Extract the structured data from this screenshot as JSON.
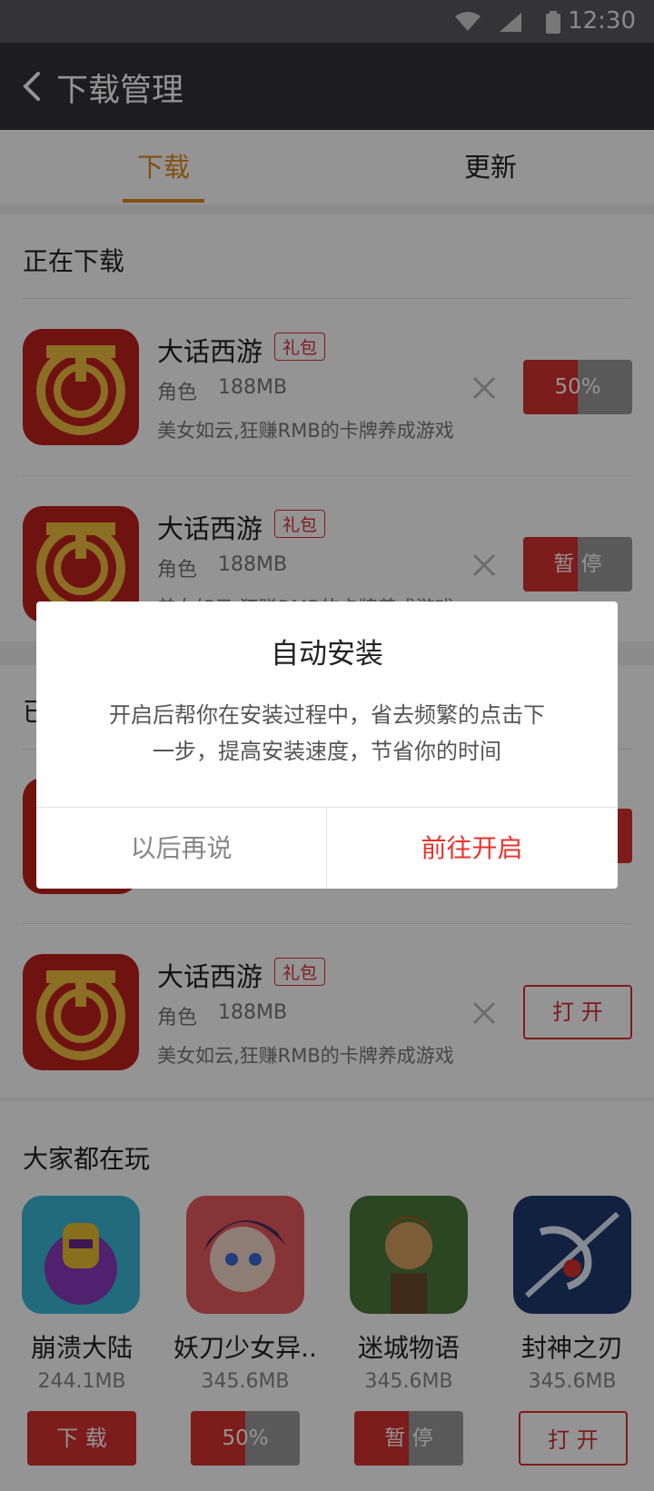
{
  "status_bar": {
    "time": "12:30"
  },
  "header": {
    "title": "下载管理"
  },
  "tabs": [
    {
      "label": "下载"
    },
    {
      "label": "更新"
    }
  ],
  "downloading": {
    "title": "正在下载",
    "items": [
      {
        "name": "大话西游",
        "badge": "礼包",
        "category": "角色",
        "size": "188MB",
        "desc": "美女如云,狂赚RMB的卡牌养成游戏",
        "action": "50%",
        "progress": 0.5
      },
      {
        "name": "大话西游",
        "badge": "礼包",
        "category": "角色",
        "size": "188MB",
        "desc": "美女如云,狂赚RMB的卡牌养成游戏",
        "action": "暂 停",
        "progress": 0.5
      }
    ]
  },
  "downloaded": {
    "title": "已",
    "items": [
      {
        "name": "大话西游",
        "badge": "礼包",
        "category": "角色",
        "size": "188MB",
        "desc": "美女如云,狂赚RMB的卡牌养成游戏",
        "action": "打 开"
      }
    ]
  },
  "popular": {
    "title": "大家都在玩",
    "items": [
      {
        "name": "崩溃大陆",
        "size": "244.1MB",
        "action": "下 载",
        "progress": 1.0
      },
      {
        "name": "妖刀少女异..",
        "size": "345.6MB",
        "action": "50%",
        "progress": 0.5
      },
      {
        "name": "迷城物语",
        "size": "345.6MB",
        "action": "暂 停",
        "progress": 0.5
      },
      {
        "name": "封神之刃",
        "size": "345.6MB",
        "action": "打 开"
      }
    ]
  },
  "dialog": {
    "title": "自动安装",
    "body": "开启后帮你在安装过程中，省去频繁的点击下一步，提高安装速度，节省你的时间",
    "cancel": "以后再说",
    "confirm": "前往开启"
  },
  "colors": {
    "accent_orange": "#e08a1e",
    "brand_red": "#d6312f",
    "confirm_red": "#e8332a",
    "header_bg": "#333338"
  }
}
